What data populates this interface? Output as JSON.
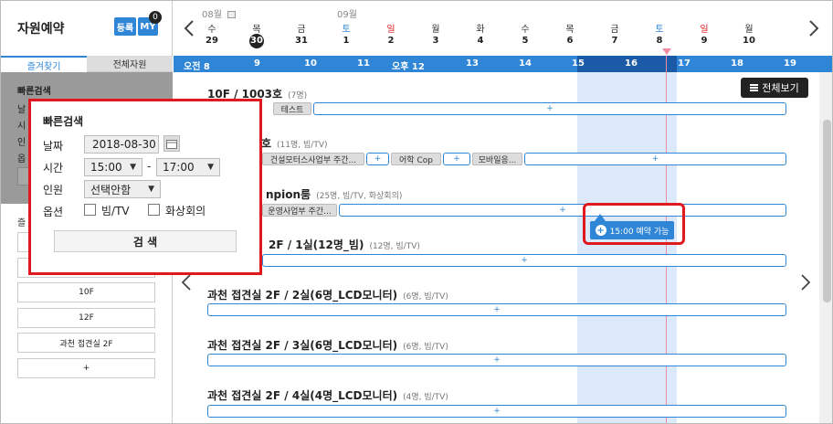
{
  "app": {
    "title": "자원예약",
    "register_label": "등록",
    "my_label": "MY",
    "my_badge": "0"
  },
  "left_tabs": {
    "favorites": "즐겨찾기",
    "all_resources": "전체자원"
  },
  "quick_search": {
    "title": "빠른검색",
    "date_label": "날짜",
    "date_value": "2018-08-30",
    "time_label": "시간",
    "time_start": "15:00",
    "time_sep": "-",
    "time_end": "17:00",
    "people_label": "인원",
    "people_value": "선택안함",
    "options_label": "옵션",
    "option_beam": "빔/TV",
    "option_video": "화상회의",
    "search_button": "검 색"
  },
  "background_form": {
    "title": "빠른검색",
    "labels": [
      "날",
      "시",
      "인",
      "옵"
    ]
  },
  "favorites": {
    "label": "즐",
    "items": [
      "10F",
      "12F",
      "과천 접견실 2F",
      "+"
    ]
  },
  "calendar": {
    "months": [
      "08월",
      "09월"
    ],
    "days": [
      {
        "dow": "수",
        "num": "29",
        "type": "weekday"
      },
      {
        "dow": "목",
        "num": "30",
        "type": "today"
      },
      {
        "dow": "금",
        "num": "31",
        "type": "weekday"
      },
      {
        "dow": "토",
        "num": "1",
        "type": "sat"
      },
      {
        "dow": "일",
        "num": "2",
        "type": "sun"
      },
      {
        "dow": "월",
        "num": "3",
        "type": "weekday"
      },
      {
        "dow": "화",
        "num": "4",
        "type": "weekday"
      },
      {
        "dow": "수",
        "num": "5",
        "type": "weekday"
      },
      {
        "dow": "목",
        "num": "6",
        "type": "weekday"
      },
      {
        "dow": "금",
        "num": "7",
        "type": "weekday"
      },
      {
        "dow": "토",
        "num": "8",
        "type": "sat"
      },
      {
        "dow": "일",
        "num": "9",
        "type": "sun"
      },
      {
        "dow": "월",
        "num": "10",
        "type": "weekday"
      }
    ]
  },
  "timeline": {
    "hours": [
      "오전 8",
      "9",
      "10",
      "11",
      "오후 12",
      "13",
      "14",
      "15",
      "16",
      "17",
      "18",
      "19"
    ]
  },
  "view_all": "전체보기",
  "rooms": [
    {
      "name": "10F / 1003호",
      "meta": "(7명)",
      "bookings": [
        "테스트"
      ],
      "slot": "+"
    },
    {
      "name": "호",
      "meta": "(11명, 빔/TV)",
      "bookings": [
        "건설모터스사업부 주간...",
        "어학 Cop",
        "모바일응..."
      ],
      "slot": "+"
    },
    {
      "name": "npion룸",
      "meta": "(25명, 빔/TV, 화상회의)",
      "bookings": [
        "운영사업부 주간..."
      ],
      "slot": "+"
    },
    {
      "name": "2F / 1실(12명_빔)",
      "meta": "(12명, 빔/TV)",
      "bookings": [],
      "slot": "+"
    },
    {
      "name": "과천 접견실 2F / 2실(6명_LCD모니터)",
      "meta": "(6명, 빔/TV)",
      "bookings": [],
      "slot": "+"
    },
    {
      "name": "과천 접견실 2F / 3실(6명_LCD모니터)",
      "meta": "(6명, 빔/TV)",
      "bookings": [],
      "slot": "+"
    },
    {
      "name": "과천 접견실 2F / 4실(4명_LCD모니터)",
      "meta": "(4명, 빔/TV)",
      "bookings": [],
      "slot": "+"
    }
  ],
  "availability": {
    "label": "15:00 예약 가능",
    "plus": "+"
  },
  "colors": {
    "accent": "#2f86d6",
    "highlight_red": "#e0191e",
    "current_time": "#f08ca0"
  },
  "icons": [
    "calendar-icon",
    "chevron-left-icon",
    "chevron-right-icon",
    "menu-icon",
    "plus-icon"
  ]
}
